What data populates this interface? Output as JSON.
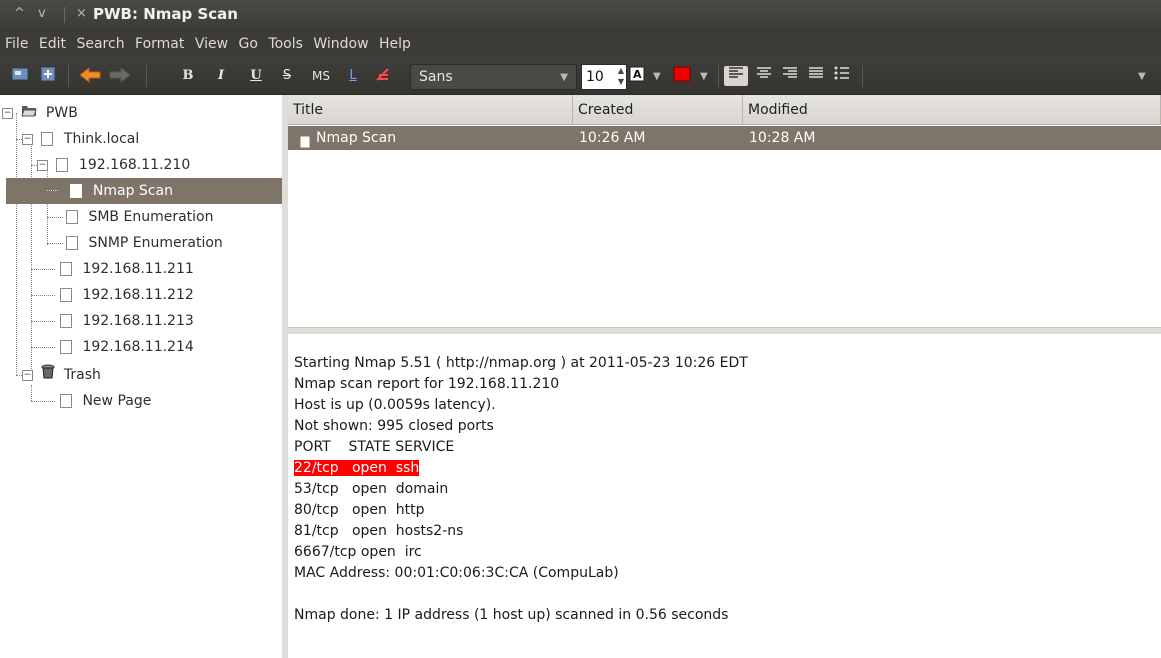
{
  "window": {
    "title": "PWB: Nmap Scan",
    "controls": [
      "^",
      "v",
      "×"
    ]
  },
  "menubar": [
    "File",
    "Edit",
    "Search",
    "Format",
    "View",
    "Go",
    "Tools",
    "Window",
    "Help"
  ],
  "toolbar": {
    "bold": "B",
    "italic": "I",
    "underline": "U",
    "strike": "S",
    "monospace": "MS",
    "link": "L",
    "font_name": "Sans",
    "font_size": "10",
    "colors": {
      "highlight": "#ee0000"
    }
  },
  "tree": [
    {
      "label": "PWB",
      "icon": "folder-icon"
    },
    {
      "label": "Think.local",
      "icon": "page-icon"
    },
    {
      "label": "192.168.11.210",
      "icon": "page-icon"
    },
    {
      "label": "Nmap Scan",
      "icon": "page-icon",
      "selected": true
    },
    {
      "label": "SMB Enumeration",
      "icon": "page-icon"
    },
    {
      "label": "SNMP Enumeration",
      "icon": "page-icon"
    },
    {
      "label": "192.168.11.211",
      "icon": "page-icon"
    },
    {
      "label": "192.168.11.212",
      "icon": "page-icon"
    },
    {
      "label": "192.168.11.213",
      "icon": "page-icon"
    },
    {
      "label": "192.168.11.214",
      "icon": "page-icon"
    },
    {
      "label": "Trash",
      "icon": "trash-icon"
    },
    {
      "label": "New Page",
      "icon": "page-icon"
    }
  ],
  "list": {
    "columns": [
      "Title",
      "Created",
      "Modified"
    ],
    "rows": [
      {
        "title": "Nmap Scan",
        "created": "10:26 AM",
        "modified": "10:28 AM"
      }
    ]
  },
  "editor": {
    "lines": [
      "Starting Nmap 5.51 ( http://nmap.org ) at 2011-05-23 10:26 EDT",
      "Nmap scan report for 192.168.11.210",
      "Host is up (0.0059s latency).",
      "Not shown: 995 closed ports",
      "PORT    STATE SERVICE",
      "22/tcp   open  ssh",
      "53/tcp   open  domain",
      "80/tcp   open  http",
      "81/tcp   open  hosts2-ns",
      "6667/tcp open  irc",
      "MAC Address: 00:01:C0:06:3C:CA (CompuLab)",
      "",
      "Nmap done: 1 IP address (1 host up) scanned in 0.56 seconds"
    ],
    "highlighted_line": 5,
    "highlight_color": "#ff0000"
  }
}
